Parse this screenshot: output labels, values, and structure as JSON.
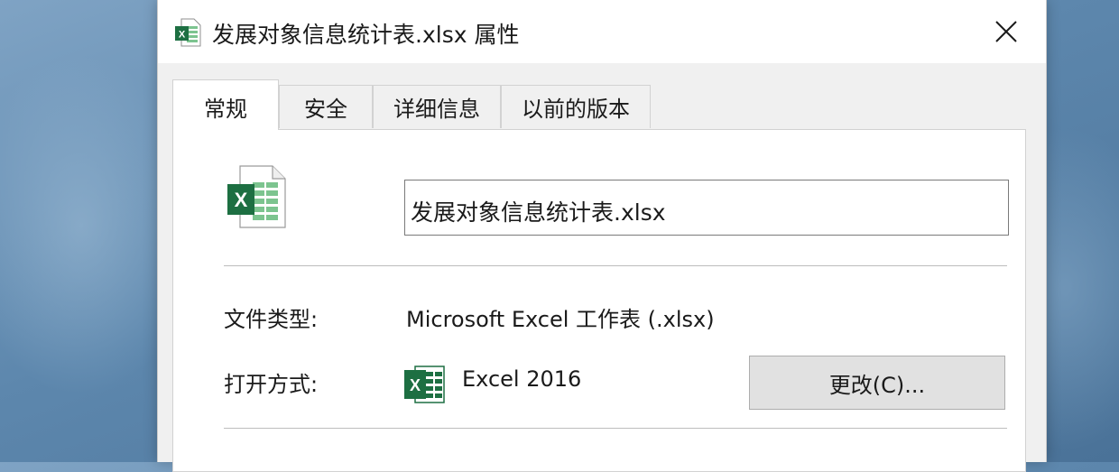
{
  "window": {
    "title": "发展对象信息统计表.xlsx 属性",
    "icon": "excel-file-icon",
    "close_icon": "close-icon"
  },
  "tabs": [
    {
      "label": "常规",
      "active": true
    },
    {
      "label": "安全",
      "active": false
    },
    {
      "label": "详细信息",
      "active": false
    },
    {
      "label": "以前的版本",
      "active": false
    }
  ],
  "general": {
    "file_icon": "excel-file-icon",
    "file_name": "发展对象信息统计表.xlsx",
    "file_type_label": "文件类型:",
    "file_type_value": "Microsoft Excel 工作表 (.xlsx)",
    "open_with_label": "打开方式:",
    "open_with_icon": "excel-app-icon",
    "open_with_value": "Excel 2016",
    "change_button": "更改(C)..."
  },
  "colors": {
    "excel_green": "#1d6f42",
    "excel_light_green": "#7cc48f"
  }
}
